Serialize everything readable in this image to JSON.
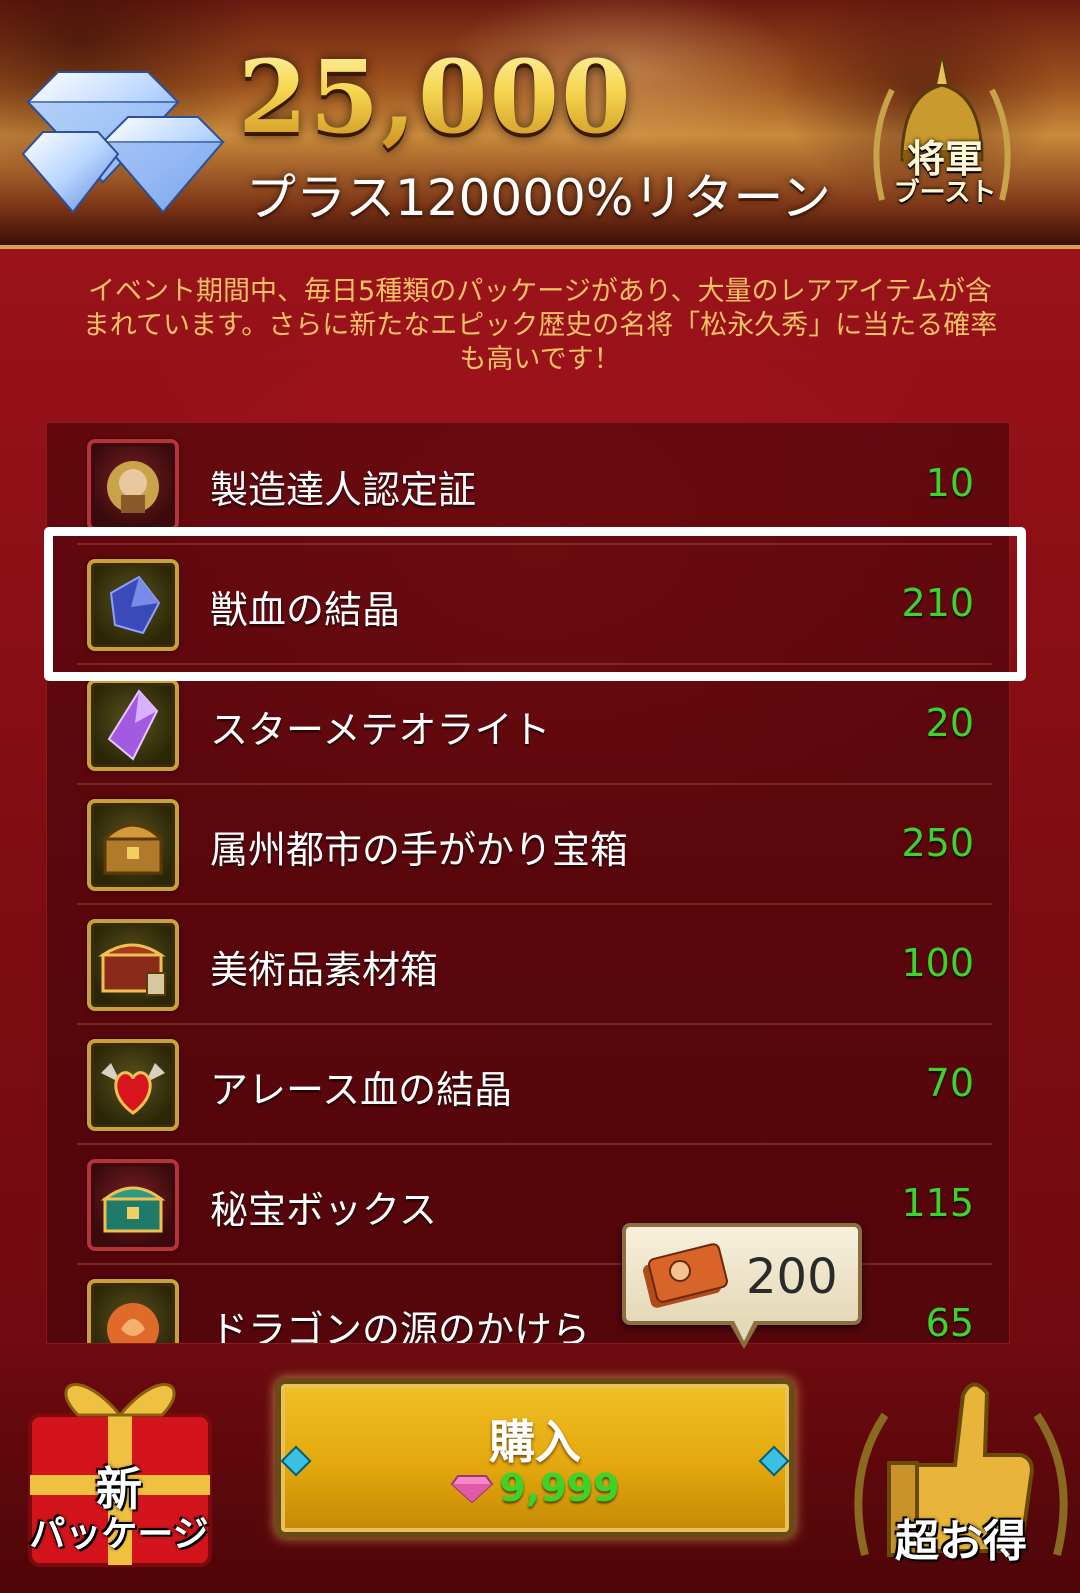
{
  "header": {
    "amount": "25,000",
    "return_text": "プラス120000%リターン",
    "boost_top": "将軍",
    "boost_bottom": "ブースト"
  },
  "description": "イベント期間中、毎日5種類のパッケージがあり、大量のレアアイテムが含まれています。さらに新たなエピック歴史の名将「松永久秀」に当たる確率も高いです！",
  "items": [
    {
      "name": "製造達人認定証",
      "qty": "10",
      "icon": "artisan-certificate-icon"
    },
    {
      "name": "獣血の結晶",
      "qty": "210",
      "icon": "beast-blood-crystal-icon"
    },
    {
      "name": "スターメテオライト",
      "qty": "20",
      "icon": "star-meteorite-icon"
    },
    {
      "name": "属州都市の手がかり宝箱",
      "qty": "250",
      "icon": "treasure-chest-icon"
    },
    {
      "name": "美術品素材箱",
      "qty": "100",
      "icon": "art-material-box-icon"
    },
    {
      "name": "アレース血の結晶",
      "qty": "70",
      "icon": "ares-blood-crystal-icon"
    },
    {
      "name": "秘宝ボックス",
      "qty": "115",
      "icon": "secret-treasure-box-icon"
    },
    {
      "name": "ドラゴンの源のかけら",
      "qty": "65",
      "icon": "dragon-source-fragment-icon"
    }
  ],
  "tooltip": {
    "amount": "200"
  },
  "buy": {
    "label": "購入",
    "price": "9,999"
  },
  "gift": {
    "line1": "新",
    "line2": "パッケージ"
  },
  "deal": {
    "label": "超お得"
  },
  "colors": {
    "quantity": "#3bd42a",
    "description": "#f2c166",
    "panel": "#7d0c12",
    "button": "#e4a80e"
  }
}
